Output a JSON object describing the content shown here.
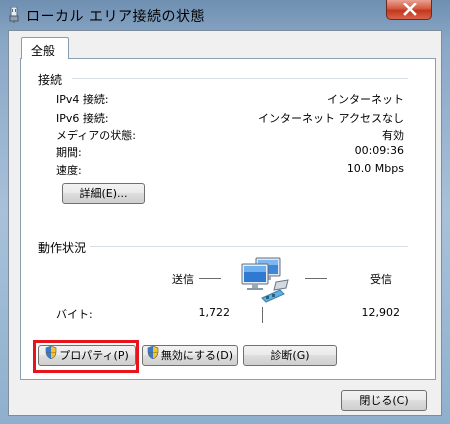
{
  "window": {
    "title": "ローカル エリア接続の状態",
    "close_label": "×"
  },
  "tabs": [
    {
      "label": "全般"
    }
  ],
  "connection": {
    "group_label": "接続",
    "rows": [
      {
        "label": "IPv4 接続:",
        "value": "インターネット"
      },
      {
        "label": "IPv6 接続:",
        "value": "インターネット アクセスなし"
      },
      {
        "label": "メディアの状態:",
        "value": "有効"
      },
      {
        "label": "期間:",
        "value": "00:09:36"
      },
      {
        "label": "速度:",
        "value": "10.0 Mbps"
      }
    ],
    "details_button": "詳細(E)..."
  },
  "activity": {
    "group_label": "動作状況",
    "sent_label": "送信",
    "received_label": "受信",
    "bytes_label": "バイト:",
    "bytes_sent": "1,722",
    "bytes_received": "12,902",
    "icon": "network-computers-icon"
  },
  "buttons": {
    "properties": "プロパティ(P)",
    "disable": "無効にする(D)",
    "diagnose": "診断(G)",
    "close": "閉じる(C)"
  },
  "colors": {
    "highlight_frame": "#e8141c",
    "close_button": "#c2381c"
  }
}
